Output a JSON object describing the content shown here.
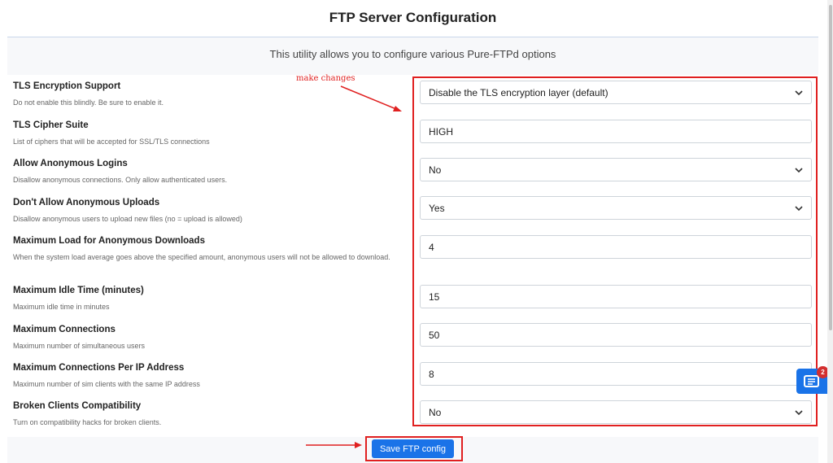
{
  "header": {
    "title": "FTP Server Configuration",
    "subtitle": "This utility allows you to configure various Pure-FTPd options"
  },
  "annotation": {
    "text": "make changes"
  },
  "options": [
    {
      "label": "TLS Encryption Support",
      "description": "Do not enable this blindly. Be sure to enable it.",
      "type": "select",
      "value": "Disable the TLS encryption layer (default)"
    },
    {
      "label": "TLS Cipher Suite",
      "description": "List of ciphers that will be accepted for SSL/TLS connections",
      "type": "input",
      "value": "HIGH"
    },
    {
      "label": "Allow Anonymous Logins",
      "description": "Disallow anonymous connections. Only allow authenticated users.",
      "type": "select",
      "value": "No"
    },
    {
      "label": "Don't Allow Anonymous Uploads",
      "description": "Disallow anonymous users to upload new files (no = upload is allowed)",
      "type": "select",
      "value": "Yes"
    },
    {
      "label": "Maximum Load for Anonymous Downloads",
      "description": "When the system load average goes above the specified amount, anonymous users will not be allowed to download.",
      "type": "input",
      "value": "4"
    },
    {
      "label": "Maximum Idle Time (minutes)",
      "description": "Maximum idle time in minutes",
      "type": "input",
      "value": "15"
    },
    {
      "label": "Maximum Connections",
      "description": "Maximum number of simultaneous users",
      "type": "input",
      "value": "50"
    },
    {
      "label": "Maximum Connections Per IP Address",
      "description": "Maximum number of sim clients with the same IP address",
      "type": "input",
      "value": "8"
    },
    {
      "label": "Broken Clients Compatibility",
      "description": "Turn on compatibility hacks for broken clients.",
      "type": "select",
      "value": "No"
    }
  ],
  "actions": {
    "save_label": "Save FTP config"
  },
  "widget": {
    "icon": "chat-icon",
    "badge_count": "2"
  },
  "colors": {
    "accent": "#1a73e8",
    "annotation": "#e02020",
    "badge": "#d32f2f"
  }
}
